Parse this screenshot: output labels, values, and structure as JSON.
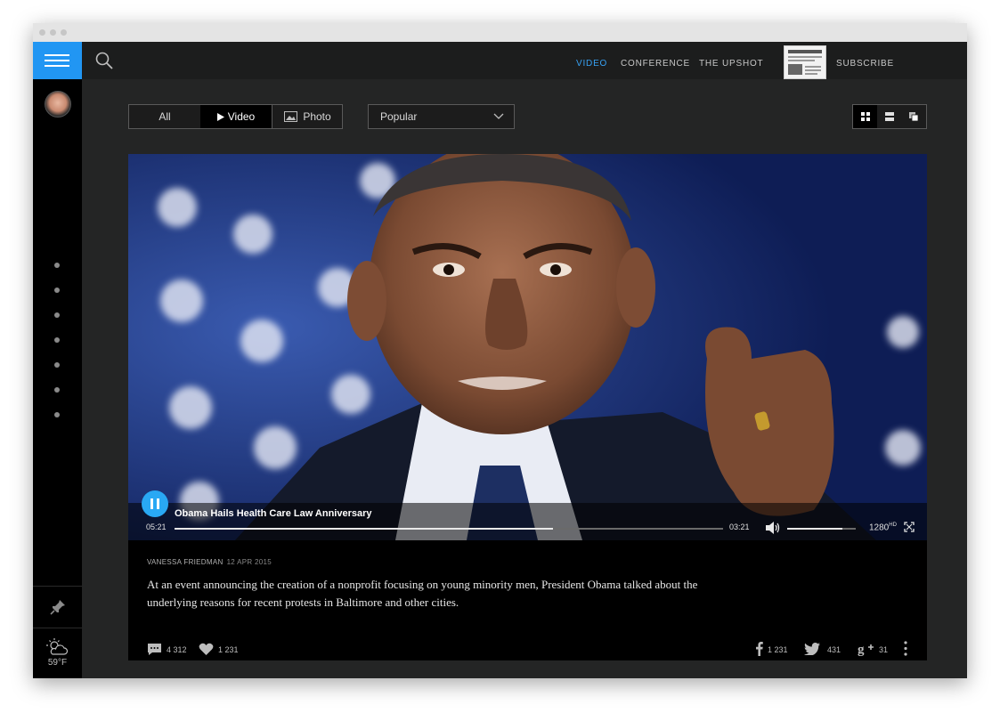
{
  "topnav": {
    "video": "VIDEO",
    "conference": "CONFERENCE",
    "upshot": "THE UPSHOT",
    "subscribe": "SUBSCRIBE",
    "active_color": "#37a2f4"
  },
  "filters": {
    "all": "All",
    "video": "Video",
    "photo": "Photo",
    "sort": "Popular"
  },
  "player": {
    "title": "Obama Hails Health Care Law Anniversary",
    "current_time": "05:21",
    "duration": "03:21",
    "quality": "1280",
    "quality_suffix": "HD",
    "progress": 0.69,
    "volume": 0.8
  },
  "article": {
    "author": "VANESSA FRIEDMAN",
    "date": "12 APR 2015",
    "description": "At an event announcing the creation of a nonprofit focusing on young minority men, President Obama talked about the underlying reasons for recent protests in Baltimore and other cities."
  },
  "stats": {
    "comments": "4 312",
    "likes": "1 231",
    "facebook": "1 231",
    "twitter": "431",
    "gplus": "31"
  },
  "weather": {
    "temp": "59°F"
  },
  "colors": {
    "accent": "#2196f3",
    "play": "#29a8f4"
  }
}
